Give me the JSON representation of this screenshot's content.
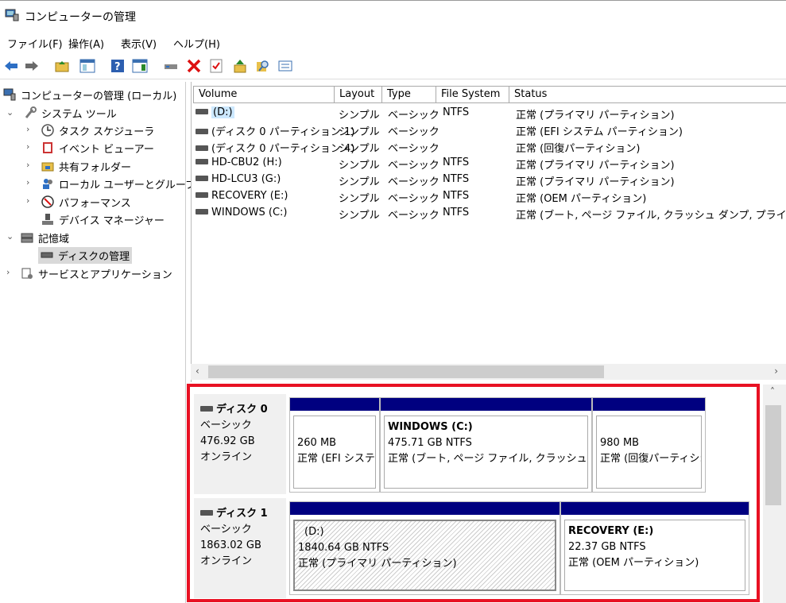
{
  "window": {
    "title": "コンピューターの管理"
  },
  "menu": [
    "ファイル(F)",
    "操作(A)",
    "表示(V)",
    "ヘルプ(H)"
  ],
  "toolbar_icons": [
    "back-arrow-icon",
    "forward-arrow-icon",
    "folder-up-icon",
    "show-hide-tree-icon",
    "help-icon",
    "show-action-pane-icon",
    "connect-drive-icon",
    "delete-icon",
    "check-properties-icon",
    "open-folder-icon",
    "search-icon",
    "details-icon"
  ],
  "tree": {
    "root": "コンピューターの管理 (ローカル)",
    "system_tools": "システム ツール",
    "task_scheduler": "タスク スケジューラ",
    "event_viewer": "イベント ビューアー",
    "shared_folders": "共有フォルダー",
    "local_users": "ローカル ユーザーとグループ",
    "performance": "パフォーマンス",
    "device_manager": "デバイス マネージャー",
    "storage": "記憶域",
    "disk_management": "ディスクの管理",
    "services_apps": "サービスとアプリケーション"
  },
  "volume_table": {
    "headers": [
      "Volume",
      "Layout",
      "Type",
      "File System",
      "Status"
    ],
    "rows": [
      {
        "volume": "(D:)",
        "layout": "シンプル",
        "type": "ベーシック",
        "fs": "NTFS",
        "status": "正常 (プライマリ パーティション)"
      },
      {
        "volume": "(ディスク 0 パーティション 1)",
        "layout": "シンプル",
        "type": "ベーシック",
        "fs": "",
        "status": "正常 (EFI システム パーティション)"
      },
      {
        "volume": "(ディスク 0 パーティション 4)",
        "layout": "シンプル",
        "type": "ベーシック",
        "fs": "",
        "status": "正常 (回復パーティション)"
      },
      {
        "volume": "HD-CBU2 (H:)",
        "layout": "シンプル",
        "type": "ベーシック",
        "fs": "NTFS",
        "status": "正常 (プライマリ パーティション)"
      },
      {
        "volume": "HD-LCU3 (G:)",
        "layout": "シンプル",
        "type": "ベーシック",
        "fs": "NTFS",
        "status": "正常 (プライマリ パーティション)"
      },
      {
        "volume": "RECOVERY (E:)",
        "layout": "シンプル",
        "type": "ベーシック",
        "fs": "NTFS",
        "status": "正常 (OEM パーティション)"
      },
      {
        "volume": "WINDOWS (C:)",
        "layout": "シンプル",
        "type": "ベーシック",
        "fs": "NTFS",
        "status": "正常 (ブート, ページ ファイル, クラッシュ ダンプ, プライマリ パーテ"
      }
    ]
  },
  "disks": [
    {
      "name": "ディスク 0",
      "type": "ベーシック",
      "size": "476.92 GB",
      "state": "オンライン",
      "partitions": [
        {
          "title": "",
          "size": "260 MB",
          "status": "正常 (EFI システ"
        },
        {
          "title": "WINDOWS  (C:)",
          "size": "475.71 GB NTFS",
          "status": "正常 (ブート, ページ ファイル, クラッシュ ダンプ"
        },
        {
          "title": "",
          "size": "980 MB",
          "status": "正常 (回復パーティシ:"
        }
      ]
    },
    {
      "name": "ディスク 1",
      "type": "ベーシック",
      "size": "1863.02 GB",
      "state": "オンライン",
      "partitions": [
        {
          "title": "(D:)",
          "size": "1840.64 GB NTFS",
          "status": "正常 (プライマリ パーティション)"
        },
        {
          "title": "RECOVERY  (E:)",
          "size": "22.37 GB NTFS",
          "status": "正常 (OEM パーティション)"
        }
      ]
    }
  ],
  "colors": {
    "partition_header": "#000080",
    "highlight_frame": "#e81123",
    "selected_volume": "#cce8ff"
  }
}
